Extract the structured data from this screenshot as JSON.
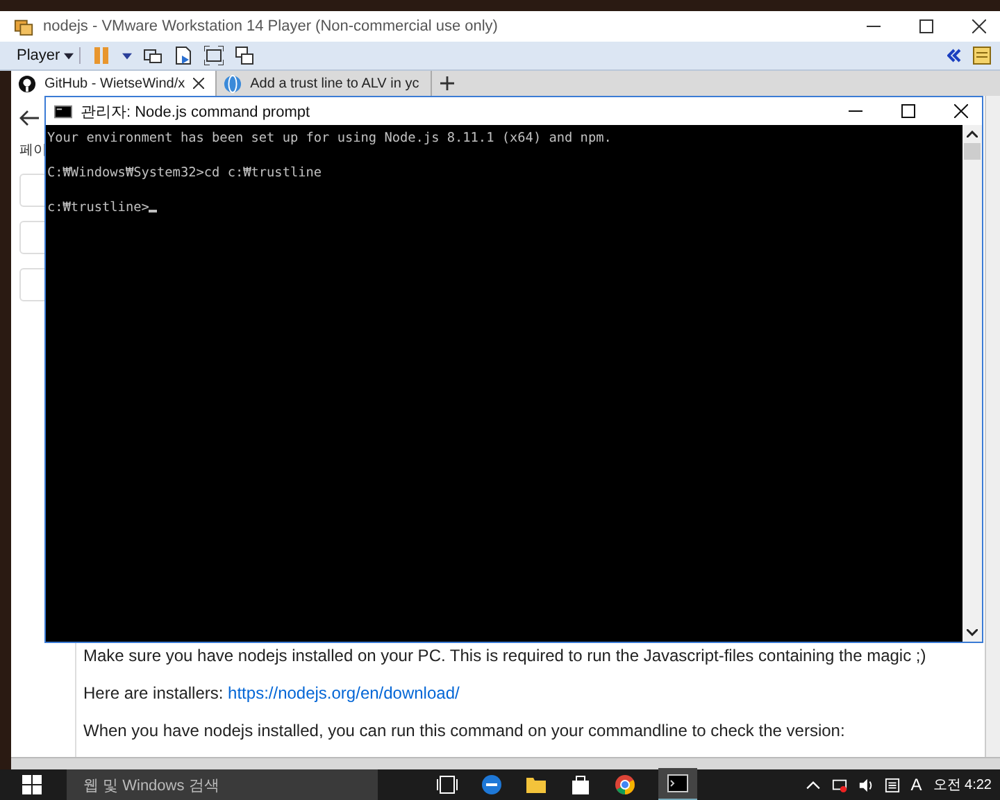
{
  "vm_window": {
    "title": "nodejs - VMware Workstation 14 Player (Non-commercial use only)",
    "menu": "Player"
  },
  "browser": {
    "tabs": [
      {
        "label": "GitHub - WietseWind/x",
        "selected": true
      },
      {
        "label": "Add a trust line to ALV in yc",
        "selected": false
      }
    ],
    "page_fragment": "페이",
    "paragraphs": [
      {
        "text": "Make sure you have nodejs installed on your PC. This is required to run the Javascript-files containing the magic ;)"
      },
      {
        "text": "Here are installers: ",
        "link": "https://nodejs.org/en/download/"
      },
      {
        "text": "When you have nodejs installed, you can run this command on your commandline to check the version:"
      }
    ]
  },
  "cmd_window": {
    "title": "관리자: Node.js command prompt",
    "lines": [
      "Your environment has been set up for using Node.js 8.11.1 (x64) and npm.",
      "C:₩Windows₩System32>cd c:₩trustline",
      "c:₩trustline>"
    ]
  },
  "taskbar": {
    "search_placeholder": "웹 및 Windows 검색",
    "ime": "A",
    "clock": "오전 4:22"
  }
}
